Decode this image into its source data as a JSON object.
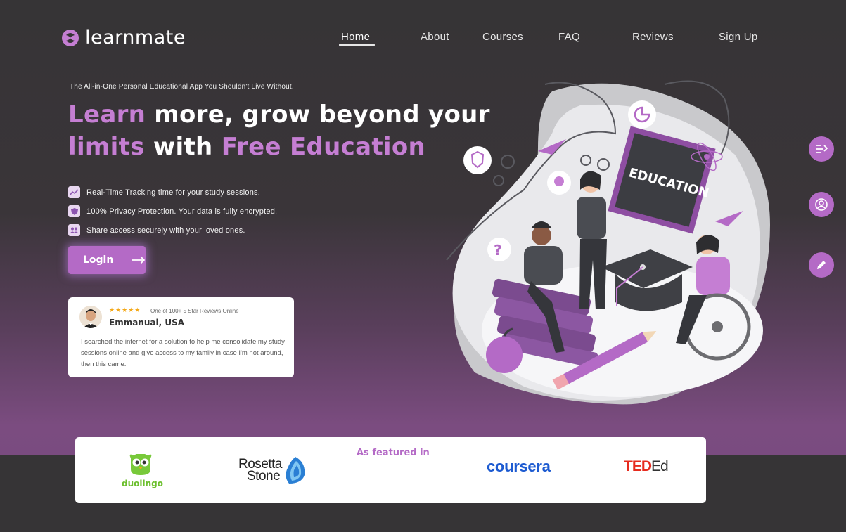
{
  "brand": {
    "name": "learnmate",
    "accent": "#c57ed3",
    "button": "#b46ac6"
  },
  "nav": {
    "items": [
      {
        "label": "Home",
        "active": true
      },
      {
        "label": "About"
      },
      {
        "label": "Courses"
      },
      {
        "label": "FAQ"
      },
      {
        "label": "Reviews"
      },
      {
        "label": "Sign Up"
      }
    ]
  },
  "hero": {
    "tagline": "The All-in-One Personal Educational App You Shouldn't Live Without.",
    "headline": {
      "w1": "Learn",
      "w2": " more, grow beyond your",
      "w3": "limits",
      "w4": " with ",
      "w5": "Free Education"
    },
    "features": [
      {
        "icon": "trend-chart-icon",
        "text": "Real-Time Tracking time for your study sessions."
      },
      {
        "icon": "shield-icon",
        "text": "100% Privacy Protection. Your data is fully encrypted."
      },
      {
        "icon": "users-icon",
        "text": "Share access securely with your loved ones."
      }
    ],
    "login_label": "Login"
  },
  "review": {
    "stars": "★★★★★",
    "meta": "One of 100+ 5 Star Reviews Online",
    "name": "Emmanual, USA",
    "text": "I searched the internet for a solution to help me consolidate my study sessions online and give access to my family in case I'm not around, then this came."
  },
  "illustration": {
    "board_text": "EDUCATION"
  },
  "side_buttons": [
    "list-arrow-icon",
    "user-circle-icon",
    "pencil-icon"
  ],
  "featured": {
    "title": "As featured in",
    "duolingo": "duolingo",
    "rosetta_line1": "Rosetta",
    "rosetta_line2": "Stone",
    "coursera": "coursera",
    "ted": "TED",
    "ed": "Ed"
  }
}
